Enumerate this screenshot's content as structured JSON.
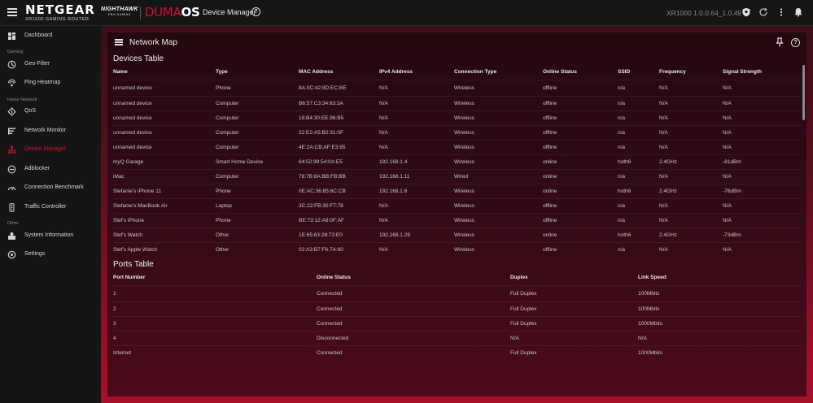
{
  "header": {
    "brand": "NETGEAR",
    "brand_sub": "XR1000 GAMING ROUTER",
    "nighthawk": "NIGHTHAWK",
    "nighthawk_sub": "PRO GAMING",
    "duma_1": "DUMA",
    "duma_2": "OS",
    "page_title": "Device Manager",
    "version": "XR1000 1.0.0.64_1.0.49"
  },
  "sidebar": {
    "sections": {
      "gaming": "Gaming",
      "home_network": "Home Network",
      "other": "Other"
    },
    "items": [
      {
        "label": "Dashboard",
        "icon": "dashboard-icon"
      },
      {
        "label": "Geo-Filter",
        "icon": "geo-filter-icon"
      },
      {
        "label": "Ping Heatmap",
        "icon": "ping-heatmap-icon"
      },
      {
        "label": "QoS",
        "icon": "qos-icon"
      },
      {
        "label": "Network Monitor",
        "icon": "network-monitor-icon"
      },
      {
        "label": "Device Manager",
        "icon": "device-manager-icon",
        "active": true
      },
      {
        "label": "Adblocker",
        "icon": "adblocker-icon"
      },
      {
        "label": "Connection Benchmark",
        "icon": "benchmark-icon"
      },
      {
        "label": "Traffic Controller",
        "icon": "traffic-controller-icon"
      },
      {
        "label": "System Information",
        "icon": "system-information-icon"
      },
      {
        "label": "Settings",
        "icon": "settings-icon"
      }
    ]
  },
  "panel": {
    "title": "Network Map"
  },
  "devices_table": {
    "title": "Devices Table",
    "columns": [
      "Name",
      "Type",
      "MAC Address",
      "IPv4 Address",
      "Connection Type",
      "Online Status",
      "SSID",
      "Frequency",
      "Signal Strength"
    ],
    "rows": [
      [
        "unnamed device",
        "Phone",
        "8A:0C:42:8D:EC:BE",
        "N/A",
        "Wireless",
        "offline",
        "n/a",
        "N/A",
        "N/A"
      ],
      [
        "unnamed device",
        "Computer",
        "B6:57:C3:34:63:3A",
        "N/A",
        "Wireless",
        "offline",
        "n/a",
        "N/A",
        "N/A"
      ],
      [
        "unnamed device",
        "Computer",
        "18:B4:30:EE:96:B5",
        "N/A",
        "Wireless",
        "offline",
        "n/a",
        "N/A",
        "N/A"
      ],
      [
        "unnamed device",
        "Computer",
        "22:E2:A5:B2:31:0F",
        "N/A",
        "Wireless",
        "offline",
        "n/a",
        "N/A",
        "N/A"
      ],
      [
        "unnamed device",
        "Computer",
        "4E:2A:CB:AF:E3:95",
        "N/A",
        "Wireless",
        "offline",
        "n/a",
        "N/A",
        "N/A"
      ],
      [
        "myQ Garage",
        "Smart Home Device",
        "64:52:99:54:0A:E5",
        "192.168.1.4",
        "Wireless",
        "online",
        "hoth6",
        "2.4GHz",
        "-81dBm"
      ],
      [
        "iMac",
        "Computer",
        "78:7B:8A:BB:FB:BB",
        "192.168.1.11",
        "Wired",
        "online",
        "n/a",
        "N/A",
        "N/A"
      ],
      [
        "Stefanie's iPhone 11",
        "Phone",
        "0E:AC:36:85:6C:CB",
        "192.168.1.6",
        "Wireless",
        "online",
        "hoth6",
        "2.4GHz",
        "-76dBm"
      ],
      [
        "Stefanie's MacBook Air",
        "Laptop",
        "3C:22:FB:30:F7:78",
        "N/A",
        "Wireless",
        "offline",
        "n/a",
        "N/A",
        "N/A"
      ],
      [
        "Stef's iPhone",
        "Phone",
        "BE:73:12:A8:0F:AF",
        "N/A",
        "Wireless",
        "offline",
        "n/a",
        "N/A",
        "N/A"
      ],
      [
        "Stef's Watch",
        "Other",
        "1E:65:63:28:73:E0",
        "192.168.1.28",
        "Wireless",
        "online",
        "hoth6",
        "2.4GHz",
        "-73dBm"
      ],
      [
        "Stef's Apple Watch",
        "Other",
        "02:A3:B7:F6:7A:60",
        "N/A",
        "Wireless",
        "offline",
        "n/a",
        "N/A",
        "N/A"
      ]
    ]
  },
  "ports_table": {
    "title": "Ports Table",
    "columns": [
      "Port Number",
      "Online Status",
      "Duplex",
      "Link Speed"
    ],
    "rows": [
      [
        "1",
        "Connected",
        "Full Duplex",
        "100Mbits"
      ],
      [
        "2",
        "Connected",
        "Full Duplex",
        "100Mbits"
      ],
      [
        "3",
        "Connected",
        "Full Duplex",
        "1000Mbits"
      ],
      [
        "4",
        "Disconnected",
        "N/A",
        "N/A"
      ],
      [
        "Internet",
        "Connected",
        "Full Duplex",
        "1000Mbits"
      ]
    ]
  },
  "colors": {
    "accent": "#d0102c",
    "background_top": "#161616",
    "sidebar": "#151515"
  }
}
